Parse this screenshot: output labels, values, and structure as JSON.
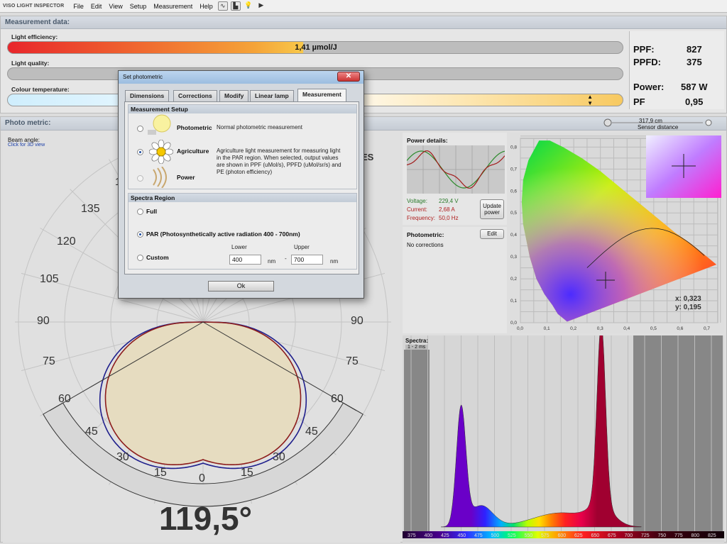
{
  "menubar": {
    "logo": "VISO LIGHT INSPECTOR",
    "items": [
      "File",
      "Edit",
      "View",
      "Setup",
      "Measurement",
      "Help"
    ]
  },
  "measurement": {
    "title": "Measurement data:",
    "light_efficiency_label": "Light efficiency:",
    "light_efficiency_value": "1,41 µmol/J",
    "light_efficiency_fill": 0.48,
    "light_quality_label": "Light quality:",
    "colour_temperature_label": "Colour temperature:"
  },
  "summary": {
    "ppf_label": "PPF:",
    "ppf_value": "827",
    "ppfd_label": "PPFD:",
    "ppfd_value": "375",
    "power_label": "Power:",
    "power_value": "587 W",
    "pf_label": "PF",
    "pf_value": "0,95"
  },
  "photometric": {
    "title": "Photo metric:",
    "sensor_distance": "317,9 cm",
    "sensor_distance_label": "Sensor distance",
    "beam_angle_label": "Beam angle:",
    "beam_angle_link": "Click for 3D view",
    "beam_angle_value": "119,5°",
    "es_label": "ES",
    "angle_labels_left": [
      "135",
      "120",
      "105",
      "90",
      "75",
      "60",
      "45",
      "30",
      "15"
    ],
    "angle_labels_right": [
      "90",
      "75",
      "60",
      "45",
      "30",
      "15"
    ],
    "angle_zero": "0",
    "top_fragment": "1"
  },
  "dialog": {
    "title": "Set photometric",
    "close": "✕",
    "tabs": [
      "Dimensions",
      "Corrections",
      "Modify",
      "Linear lamp",
      "Measurement"
    ],
    "setup_header": "Measurement Setup",
    "photometric_label": "Photometric",
    "photometric_desc": "Normal photometric measurement",
    "agriculture_label": "Agriculture",
    "agriculture_desc": "Agriculture light measurement for measuring light in the PAR region. When selected, output values are shown in PPF (uMol/s), PPFD (uMol/sr/s) and PE (photon efficiency)",
    "power_label": "Power",
    "spectra_header": "Spectra Region",
    "full_label": "Full",
    "par_label": "PAR (Photosynthetically active radiation 400 - 700nm)",
    "custom_label": "Custom",
    "lower_label": "Lower",
    "upper_label": "Upper",
    "lower_value": "400",
    "upper_value": "700",
    "nm": "nm",
    "dash": "-",
    "ok": "Ok"
  },
  "power_details": {
    "title": "Power details:",
    "voltage_label": "Voltage:",
    "voltage_value": "229,4 V",
    "current_label": "Current:",
    "current_value": "2,68 A",
    "frequency_label": "Frequency:",
    "frequency_value": "50,0 Hz",
    "update_button": "Update power"
  },
  "photometric_panel": {
    "title": "Photometric:",
    "edit_button": "Edit",
    "status": "No corrections"
  },
  "cie": {
    "x_label": "x: 0,323",
    "y_label": "y: 0,195",
    "x_ticks": [
      "0,0",
      "0,1",
      "0,2",
      "0,3",
      "0,4",
      "0,5",
      "0,6",
      "0,7"
    ],
    "y_ticks": [
      "0,8",
      "0,7",
      "0,6",
      "0,5",
      "0,4",
      "0,3",
      "0,2",
      "0,1",
      "0,0"
    ]
  },
  "spectra": {
    "title": "Spectra:",
    "sub": "1 - 2 ms",
    "ticks": [
      "375",
      "400",
      "425",
      "450",
      "475",
      "500",
      "525",
      "550",
      "575",
      "600",
      "625",
      "650",
      "675",
      "700",
      "725",
      "750",
      "775",
      "800",
      "825"
    ]
  }
}
